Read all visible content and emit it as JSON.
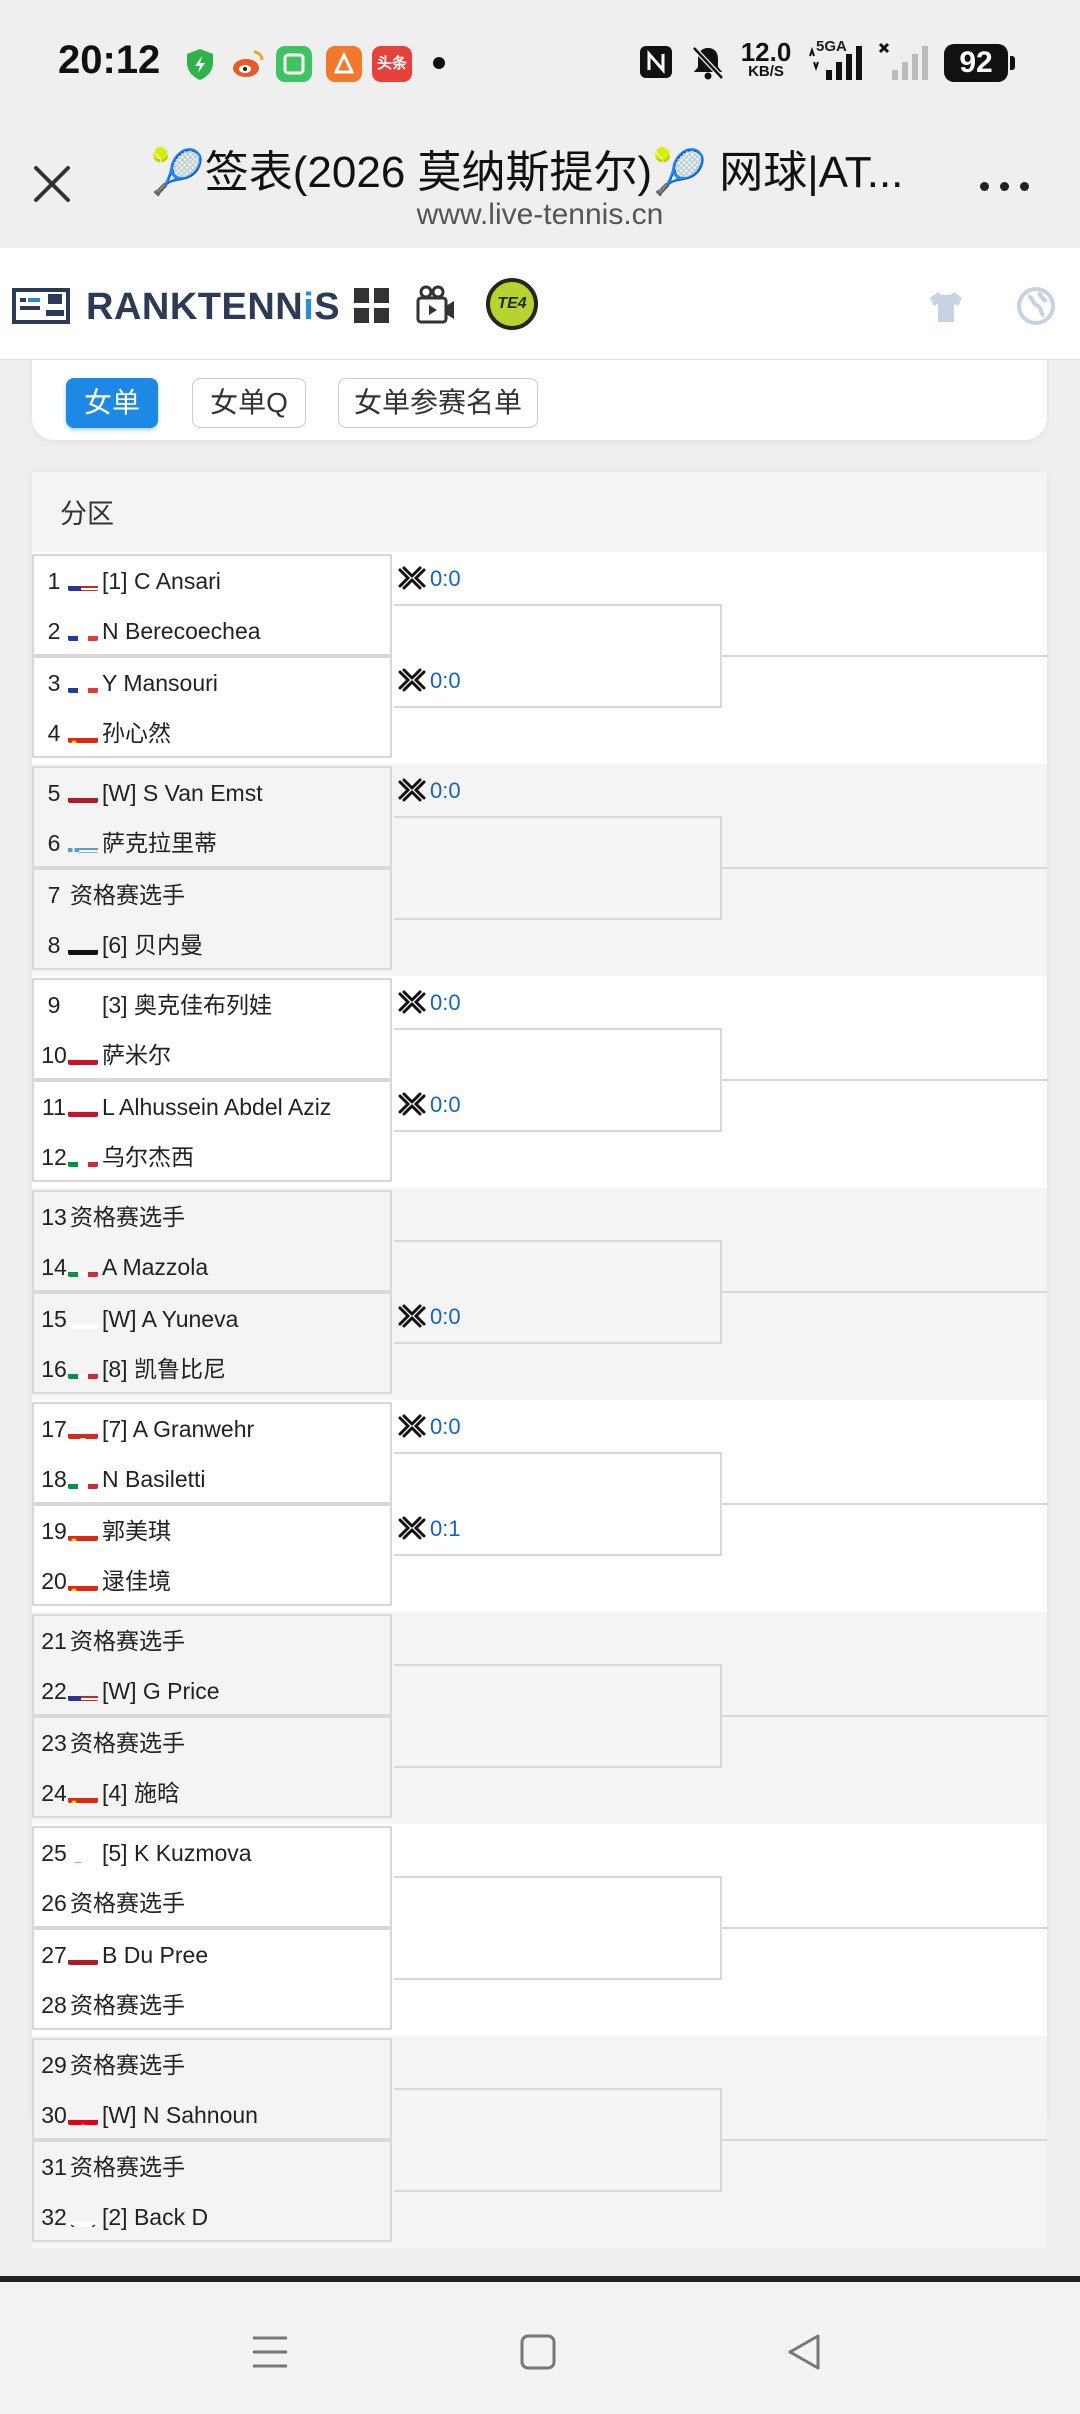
{
  "status_bar": {
    "time": "20:12",
    "speed_value": "12.0",
    "speed_unit": "KB/S",
    "network": "5GA",
    "battery": "92",
    "apps": [
      {
        "icon": "shield-icon",
        "color": "#2fb24a",
        "text": ""
      },
      {
        "icon": "weibo-icon",
        "color": "#e85a2a",
        "text": ""
      },
      {
        "icon": "green-app-icon",
        "color": "#3ec460",
        "text": ""
      },
      {
        "icon": "orange-app-icon",
        "color": "#f2792b",
        "text": ""
      },
      {
        "icon": "toutiao-icon",
        "color": "#e8403a",
        "text": "头条"
      }
    ]
  },
  "browser": {
    "title": "🎾签表(2026 莫纳斯提尔)🎾 网球|AT...",
    "url": "www.live-tennis.cn"
  },
  "site_nav": {
    "logo_part1": "RANKTENN",
    "logo_part2": "i",
    "logo_part3": "S",
    "badge": "TE4"
  },
  "tabs": [
    {
      "label": "女单",
      "active": true
    },
    {
      "label": "女单Q",
      "active": false
    },
    {
      "label": "女单参赛名单",
      "active": false
    }
  ],
  "draw": {
    "section_label": "分区",
    "players": [
      {
        "num": "1",
        "flag": "us",
        "name": "[1] C Ansari"
      },
      {
        "num": "2",
        "flag": "fr",
        "name": "N Berecoechea"
      },
      {
        "num": "3",
        "flag": "fr",
        "name": "Y Mansouri"
      },
      {
        "num": "4",
        "flag": "cn",
        "name": "孙心然"
      },
      {
        "num": "5",
        "flag": "nl",
        "name": "[W] S Van Emst"
      },
      {
        "num": "6",
        "flag": "gr",
        "name": "萨克拉里蒂"
      },
      {
        "num": "7",
        "flag": "",
        "name": "资格赛选手"
      },
      {
        "num": "8",
        "flag": "de",
        "name": "[6] 贝内曼"
      },
      {
        "num": "9",
        "flag": "ru",
        "name": "[3] 奥克佳布列娃"
      },
      {
        "num": "10",
        "flag": "eg",
        "name": "萨米尔"
      },
      {
        "num": "11",
        "flag": "eg",
        "name": "L Alhussein Abdel Aziz"
      },
      {
        "num": "12",
        "flag": "it",
        "name": "乌尔杰西"
      },
      {
        "num": "13",
        "flag": "",
        "name": "资格赛选手"
      },
      {
        "num": "14",
        "flag": "it",
        "name": "A Mazzola"
      },
      {
        "num": "15",
        "flag": "ru",
        "name": "[W] A Yuneva"
      },
      {
        "num": "16",
        "flag": "it",
        "name": "[8] 凯鲁比尼"
      },
      {
        "num": "17",
        "flag": "ch",
        "name": "[7] A Granwehr"
      },
      {
        "num": "18",
        "flag": "it",
        "name": "N Basiletti"
      },
      {
        "num": "19",
        "flag": "cn",
        "name": "郭美琪"
      },
      {
        "num": "20",
        "flag": "cn",
        "name": "逯佳境"
      },
      {
        "num": "21",
        "flag": "",
        "name": "资格赛选手"
      },
      {
        "num": "22",
        "flag": "us",
        "name": "[W] G Price"
      },
      {
        "num": "23",
        "flag": "",
        "name": "资格赛选手"
      },
      {
        "num": "24",
        "flag": "cn",
        "name": "[4] 施晗"
      },
      {
        "num": "25",
        "flag": "sk",
        "name": "[5] K Kuzmova"
      },
      {
        "num": "26",
        "flag": "",
        "name": "资格赛选手"
      },
      {
        "num": "27",
        "flag": "nl",
        "name": "B Du Pree"
      },
      {
        "num": "28",
        "flag": "",
        "name": "资格赛选手"
      },
      {
        "num": "29",
        "flag": "",
        "name": "资格赛选手"
      },
      {
        "num": "30",
        "flag": "tn",
        "name": "[W] N Sahnoun"
      },
      {
        "num": "31",
        "flag": "",
        "name": "资格赛选手"
      },
      {
        "num": "32",
        "flag": "kr",
        "name": "[2] Back D"
      }
    ],
    "scores": [
      {
        "match": 1,
        "text": "0:0"
      },
      {
        "match": 2,
        "text": "0:0"
      },
      {
        "match": 3,
        "text": "0:0"
      },
      {
        "match": 4,
        "text": ""
      },
      {
        "match": 5,
        "text": "0:0"
      },
      {
        "match": 6,
        "text": "0:0"
      },
      {
        "match": 7,
        "text": ""
      },
      {
        "match": 8,
        "text": "0:0"
      },
      {
        "match": 9,
        "text": "0:0"
      },
      {
        "match": 10,
        "text": "0:1"
      },
      {
        "match": 11,
        "text": ""
      },
      {
        "match": 12,
        "text": ""
      },
      {
        "match": 13,
        "text": ""
      },
      {
        "match": 14,
        "text": ""
      },
      {
        "match": 15,
        "text": ""
      },
      {
        "match": 16,
        "text": ""
      }
    ]
  },
  "colors": {
    "accent": "#1e88e5",
    "score": "#1565c0"
  }
}
